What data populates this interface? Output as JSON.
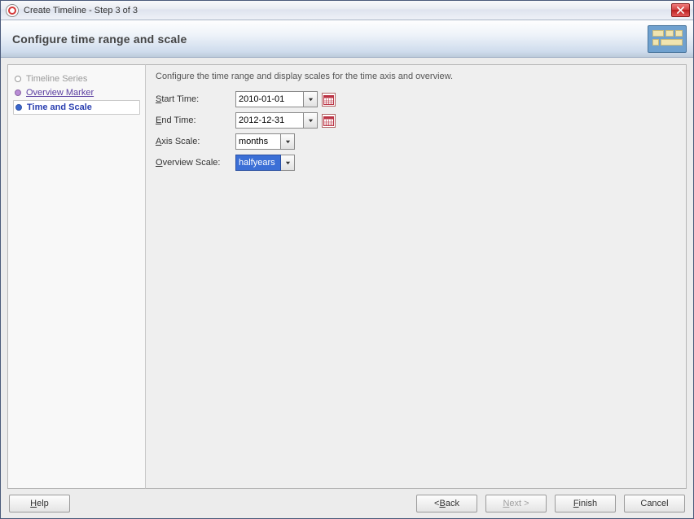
{
  "window": {
    "title": "Create Timeline - Step 3 of 3"
  },
  "header": {
    "title": "Configure time range and scale"
  },
  "nav": {
    "items": [
      {
        "label": "Timeline Series"
      },
      {
        "label": "Overview Marker"
      },
      {
        "label": "Time and Scale"
      }
    ]
  },
  "main": {
    "instruction": "Configure the time range and display scales for the time axis and overview.",
    "labels": {
      "start": "Start Time:",
      "end": "End Time:",
      "axis": "Axis Scale:",
      "overview": "Overview Scale:"
    },
    "values": {
      "start": "2010-01-01",
      "end": "2012-12-31",
      "axis": "months",
      "overview": "halfyears"
    }
  },
  "footer": {
    "help": "Help",
    "back": "< Back",
    "next": "Next >",
    "finish": "Finish",
    "cancel": "Cancel"
  }
}
